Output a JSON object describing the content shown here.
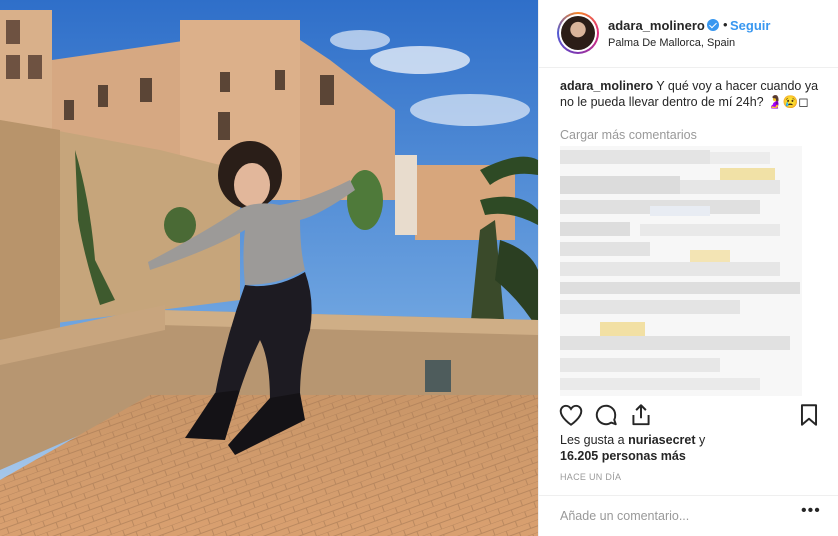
{
  "post": {
    "username": "adara_molinero",
    "verified": true,
    "dot": "•",
    "follow_label": "Seguir",
    "location": "Palma De Mallorca, Spain",
    "caption_user": "adara_molinero",
    "caption_text": "Y qué voy a hacer cuando ya no le pueda llevar dentro de mí 24h? 🤰😢◻",
    "load_more_label": "Cargar más comentarios",
    "likes_prefix": "Les gusta a",
    "likes_user": "nuriasecret",
    "likes_and": "y",
    "likes_count": "16.205 personas más",
    "time_ago": "HACE UN DÍA",
    "comment_placeholder": "Añade un comentario...",
    "more_icon_text": "•••"
  },
  "icons": {
    "like": "heart-icon",
    "comment": "comment-bubble-icon",
    "share": "share-icon",
    "save": "bookmark-icon",
    "verified": "verified-badge-icon"
  },
  "colors": {
    "accent": "#3897f0",
    "text": "#262626",
    "muted": "#999999",
    "border": "#efefef"
  }
}
